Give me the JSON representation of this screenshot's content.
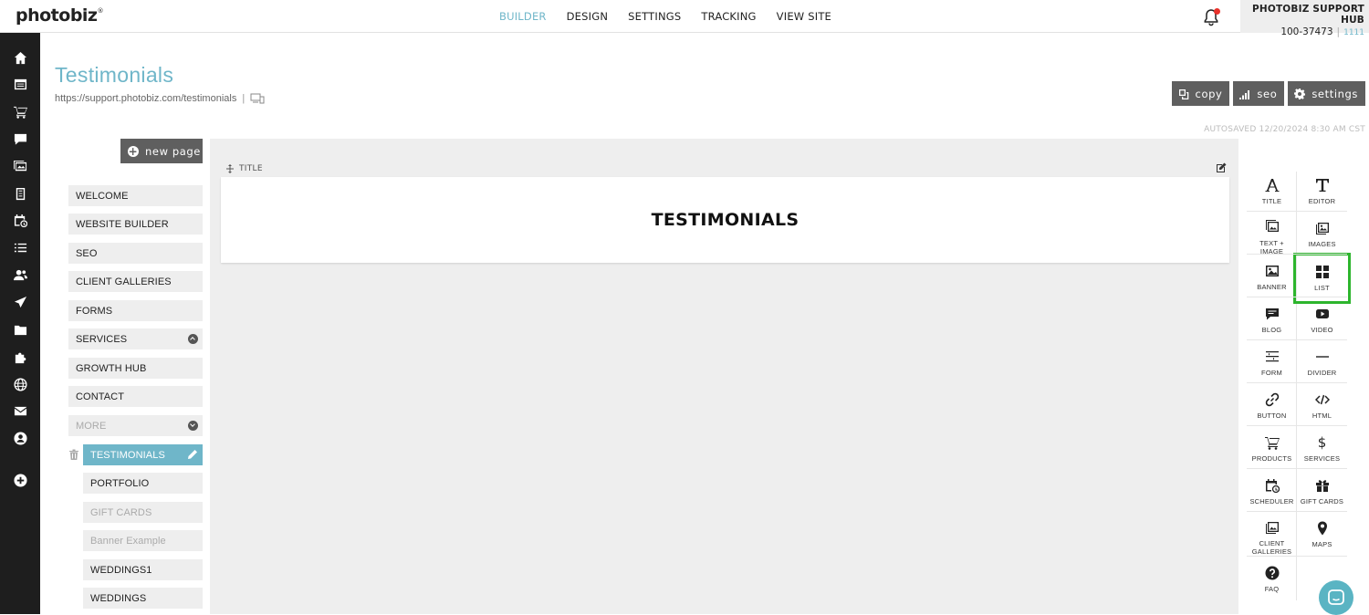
{
  "brand": {
    "logo": "photobiz",
    "logo_mark": "®"
  },
  "topnav": [
    {
      "label": "BUILDER",
      "active": true
    },
    {
      "label": "DESIGN"
    },
    {
      "label": "SETTINGS"
    },
    {
      "label": "TRACKING"
    },
    {
      "label": "VIEW SITE"
    }
  ],
  "account": {
    "name": "PHOTOBIZ SUPPORT HUB",
    "id": "100-37473",
    "id2": "1111"
  },
  "rail_icons": [
    "home-icon",
    "pages-icon",
    "cart-icon",
    "chat-icon",
    "gallery-icon",
    "forms-icon",
    "scheduler-icon",
    "list-icon",
    "contacts-icon",
    "send-icon",
    "folder-icon",
    "puzzle-icon",
    "globe-icon",
    "mail-icon",
    "user-icon",
    "add-icon"
  ],
  "page": {
    "title": "Testimonials",
    "url": "https://support.photobiz.com/testimonials",
    "url_sep": "|",
    "autosaved": "AUTOSAVED 12/20/2024 8:30 AM CST"
  },
  "actions": {
    "copy": "copy",
    "seo": "seo",
    "settings": "settings"
  },
  "new_page": "new page",
  "pages_list": [
    {
      "label": "WELCOME"
    },
    {
      "label": "WEBSITE BUILDER"
    },
    {
      "label": "SEO"
    },
    {
      "label": "CLIENT GALLERIES"
    },
    {
      "label": "FORMS"
    },
    {
      "label": "SERVICES"
    },
    {
      "label": "GROWTH HUB"
    },
    {
      "label": "CONTACT"
    },
    {
      "label": "MORE"
    },
    {
      "label": "TESTIMONIALS"
    },
    {
      "label": "PORTFOLIO"
    },
    {
      "label": "GIFT CARDS"
    },
    {
      "label": "Banner Example"
    },
    {
      "label": "WEDDINGS1"
    },
    {
      "label": "WEDDINGS"
    }
  ],
  "section": {
    "label": "TITLE",
    "heading": "TESTIMONIALS"
  },
  "widgets": [
    {
      "label": "TITLE",
      "icon": "title-icon"
    },
    {
      "label": "EDITOR",
      "icon": "editor-icon"
    },
    {
      "label": "TEXT + IMAGE",
      "icon": "text-image-icon"
    },
    {
      "label": "IMAGES",
      "icon": "images-icon"
    },
    {
      "label": "BANNER",
      "icon": "banner-icon"
    },
    {
      "label": "LIST",
      "icon": "list-grid-icon"
    },
    {
      "label": "BLOG",
      "icon": "blog-icon"
    },
    {
      "label": "VIDEO",
      "icon": "video-icon"
    },
    {
      "label": "FORM",
      "icon": "form-icon"
    },
    {
      "label": "DIVIDER",
      "icon": "divider-icon"
    },
    {
      "label": "BUTTON",
      "icon": "link-icon"
    },
    {
      "label": "HTML",
      "icon": "code-icon"
    },
    {
      "label": "PRODUCTS",
      "icon": "cart-icon"
    },
    {
      "label": "SERVICES",
      "icon": "dollar-icon"
    },
    {
      "label": "SCHEDULER",
      "icon": "scheduler-icon"
    },
    {
      "label": "GIFT CARDS",
      "icon": "gift-icon"
    },
    {
      "label": "CLIENT GALLERIES",
      "icon": "client-galleries-icon"
    },
    {
      "label": "MAPS",
      "icon": "map-pin-icon"
    },
    {
      "label": "FAQ",
      "icon": "question-icon"
    }
  ],
  "colors": {
    "accent": "#6fb6c9",
    "rail": "#1e1e1e",
    "button": "#5f5f5f",
    "highlight": "#2db52d",
    "chat": "#5ab4c3"
  }
}
